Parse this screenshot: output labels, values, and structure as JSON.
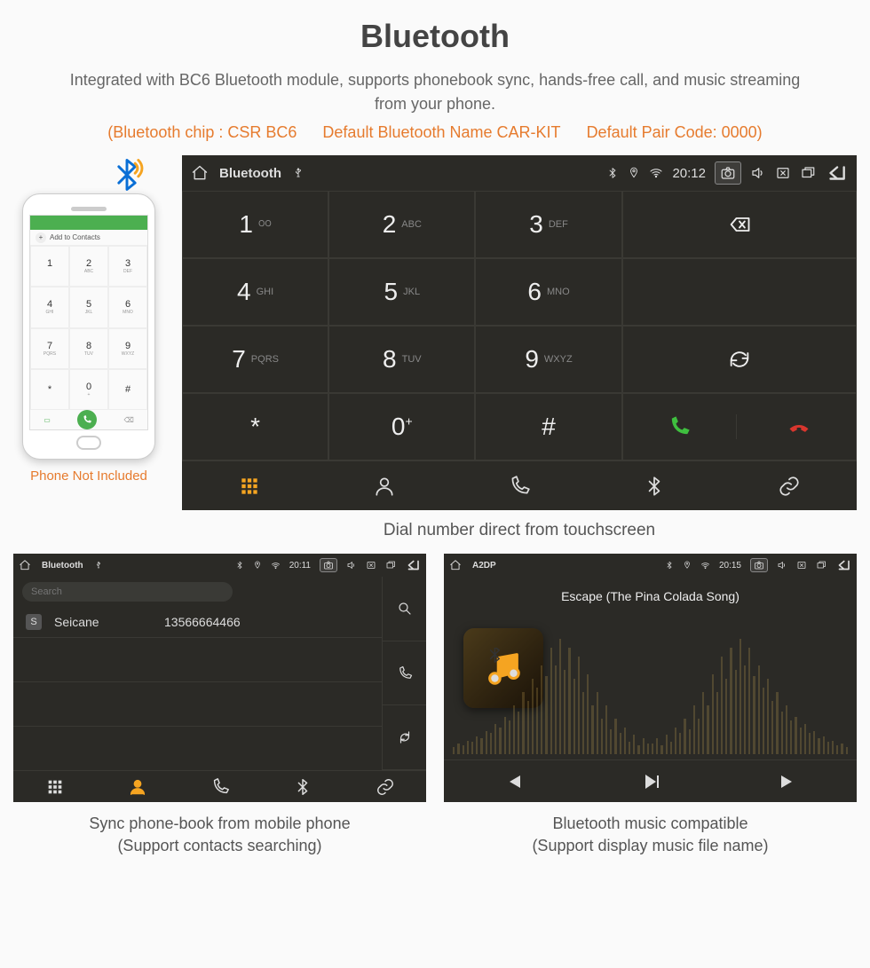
{
  "header": {
    "title": "Bluetooth",
    "subtitle": "Integrated with BC6 Bluetooth module, supports phonebook sync, hands-free call, and music streaming from your phone.",
    "specs": {
      "chip": "(Bluetooth chip : CSR BC6",
      "name": "Default Bluetooth Name CAR-KIT",
      "code": "Default Pair Code: 0000)"
    }
  },
  "phone_mock": {
    "caption": "Phone Not Included",
    "add_label": "Add to Contacts"
  },
  "dialer": {
    "status": {
      "app": "Bluetooth",
      "time": "20:12"
    },
    "keys": [
      {
        "n": "1",
        "l": "∞"
      },
      {
        "n": "2",
        "l": "ABC"
      },
      {
        "n": "3",
        "l": "DEF"
      },
      {
        "n": "4",
        "l": "GHI"
      },
      {
        "n": "5",
        "l": "JKL"
      },
      {
        "n": "6",
        "l": "MNO"
      },
      {
        "n": "7",
        "l": "PQRS"
      },
      {
        "n": "8",
        "l": "TUV"
      },
      {
        "n": "9",
        "l": "WXYZ"
      },
      {
        "n": "*",
        "l": ""
      },
      {
        "n": "0",
        "l": "+"
      },
      {
        "n": "#",
        "l": ""
      }
    ],
    "caption": "Dial number direct from touchscreen"
  },
  "contacts": {
    "status": {
      "app": "Bluetooth",
      "time": "20:11"
    },
    "search_placeholder": "Search",
    "rows": [
      {
        "badge": "S",
        "name": "Seicane",
        "number": "13566664466"
      }
    ],
    "caption_l1": "Sync phone-book from mobile phone",
    "caption_l2": "(Support contacts searching)"
  },
  "music": {
    "status": {
      "app": "A2DP",
      "time": "20:15"
    },
    "song": "Escape (The Pina Colada Song)",
    "caption_l1": "Bluetooth music compatible",
    "caption_l2": "(Support display music file name)"
  }
}
